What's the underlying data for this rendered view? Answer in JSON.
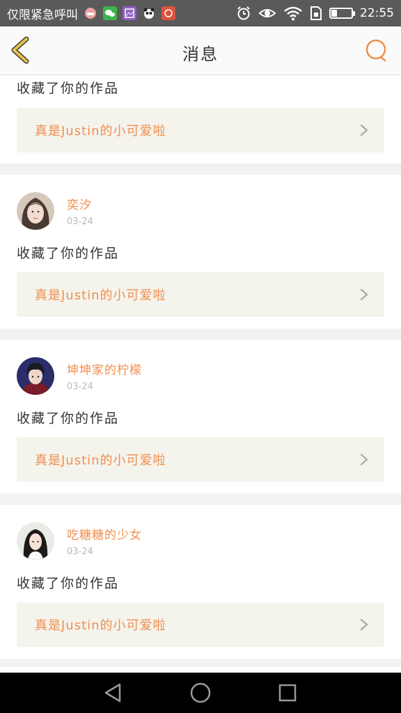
{
  "status_bar": {
    "carrier": "仅限紧急呼叫",
    "time": "22:55",
    "battery_level": 0.3,
    "left_icons": [
      "face-app-icon",
      "wechat-icon",
      "gallery-icon",
      "panda-app-icon",
      "red-app-icon"
    ],
    "right_icons": [
      "alarm-icon",
      "eye-icon",
      "wifi-icon",
      "sim-icon",
      "battery-icon"
    ]
  },
  "header": {
    "title": "消息",
    "back_icon": "chevron-left-icon",
    "search_icon": "search-icon"
  },
  "colors": {
    "accent": "#f08f4f",
    "back_icon": "#e8c24a",
    "ref_box_bg": "#f4f3ec",
    "page_bg": "#f2f2f2"
  },
  "partial_card": {
    "message": "收藏了你的作品",
    "ref_text": "真是Justin的小可爱啦"
  },
  "notifications": [
    {
      "username": "奕汐",
      "date": "03-24",
      "message": "收藏了你的作品",
      "ref_text": "真是Justin的小可爱啦"
    },
    {
      "username": "坤坤家的柠檬",
      "date": "03-24",
      "message": "收藏了你的作品",
      "ref_text": "真是Justin的小可爱啦"
    },
    {
      "username": "吃糖糖的少女",
      "date": "03-24",
      "message": "收藏了你的作品",
      "ref_text": "真是Justin的小可爱啦"
    }
  ],
  "nav_bar": {
    "buttons": [
      "back-triangle-icon",
      "home-circle-icon",
      "recents-square-icon"
    ]
  }
}
